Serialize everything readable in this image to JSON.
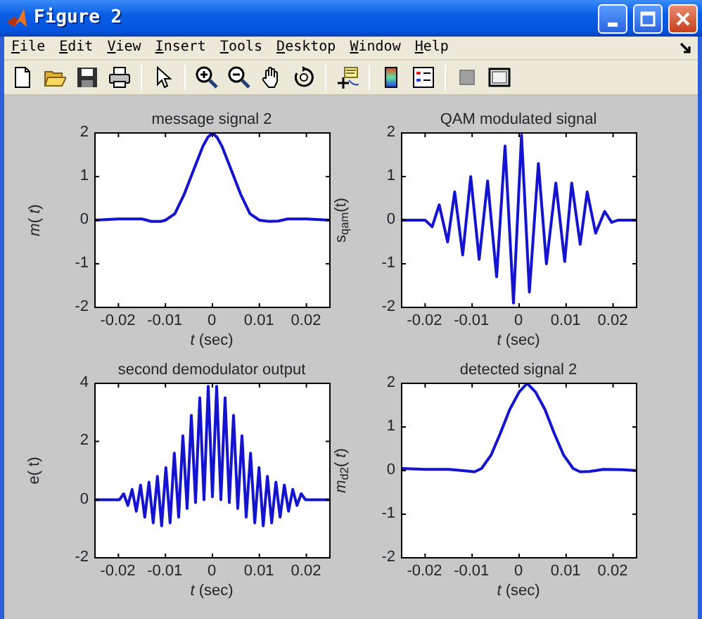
{
  "window": {
    "title": "Figure 2"
  },
  "menu": [
    "File",
    "Edit",
    "View",
    "Insert",
    "Tools",
    "Desktop",
    "Window",
    "Help"
  ],
  "subplots": [
    {
      "chart_data": {
        "type": "line",
        "title": "message signal 2",
        "xlabel": "*t* (sec)",
        "ylabel": "*m*( *t*)",
        "xlim": [
          -0.025,
          0.025
        ],
        "ylim": [
          -2,
          2
        ],
        "xticks": [
          -0.02,
          -0.01,
          0,
          0.01,
          0.02
        ],
        "yticks": [
          -2,
          -1,
          0,
          1,
          2
        ],
        "x": [
          -0.025,
          -0.02,
          -0.015,
          -0.013,
          -0.011,
          -0.01,
          -0.008,
          -0.006,
          -0.004,
          -0.002,
          -0.001,
          0,
          0.001,
          0.002,
          0.004,
          0.006,
          0.008,
          0.01,
          0.012,
          0.014,
          0.016,
          0.02,
          0.025
        ],
        "series": [
          {
            "values": [
              0,
              0.03,
              0.03,
              -0.03,
              -0.03,
              0,
              0.15,
              0.6,
              1.15,
              1.7,
              1.9,
              2,
              1.9,
              1.7,
              1.15,
              0.6,
              0.15,
              0,
              -0.03,
              -0.02,
              0.03,
              0.03,
              0
            ]
          }
        ]
      }
    },
    {
      "chart_data": {
        "type": "line",
        "title": "QAM modulated signal",
        "xlabel": "*t* (sec)",
        "ylabel": "s$_{qam}$(t)",
        "xlim": [
          -0.025,
          0.025
        ],
        "ylim": [
          -2,
          2
        ],
        "xticks": [
          -0.02,
          -0.01,
          0,
          0.01,
          0.02
        ],
        "yticks": [
          -2,
          -1,
          0,
          1,
          2
        ],
        "x": [
          -0.025,
          -0.02,
          -0.0185,
          -0.017,
          -0.0152,
          -0.0137,
          -0.012,
          -0.0103,
          -0.0085,
          -0.0067,
          -0.0048,
          -0.003,
          -0.0012,
          0.0005,
          0.0022,
          0.0041,
          0.0058,
          0.0078,
          0.0097,
          0.0112,
          0.013,
          0.0145,
          0.0163,
          0.0182,
          0.0197,
          0.021,
          0.025
        ],
        "series": [
          {
            "values": [
              0,
              0,
              -0.15,
              0.35,
              -0.5,
              0.65,
              -0.8,
              1,
              -0.9,
              0.9,
              -1.3,
              1.7,
              -1.9,
              1.95,
              -1.65,
              1.3,
              -1,
              0.85,
              -0.95,
              0.85,
              -0.55,
              0.65,
              -0.3,
              0.2,
              -0.05,
              0,
              0
            ]
          }
        ]
      }
    },
    {
      "chart_data": {
        "type": "line",
        "title": "second demodulator output",
        "xlabel": "*t* (sec)",
        "ylabel": "e( t)",
        "xlim": [
          -0.025,
          0.025
        ],
        "ylim": [
          -2,
          4
        ],
        "xticks": [
          -0.02,
          -0.01,
          0,
          0.01,
          0.02
        ],
        "yticks": [
          -2,
          0,
          2,
          4
        ],
        "x": [
          -0.025,
          -0.0198,
          -0.0189,
          -0.018,
          -0.0171,
          -0.0162,
          -0.0153,
          -0.0144,
          -0.0135,
          -0.0126,
          -0.0117,
          -0.0108,
          -0.0099,
          -0.009,
          -0.0081,
          -0.0072,
          -0.0063,
          -0.0054,
          -0.0045,
          -0.0036,
          -0.0027,
          -0.0018,
          -0.0009,
          0,
          0.0009,
          0.0018,
          0.0027,
          0.0036,
          0.0045,
          0.0054,
          0.0063,
          0.0072,
          0.0081,
          0.009,
          0.0099,
          0.0108,
          0.0117,
          0.0126,
          0.0135,
          0.0144,
          0.0153,
          0.0162,
          0.0171,
          0.018,
          0.0189,
          0.0198,
          0.025
        ],
        "series": [
          {
            "values": [
              0,
              0,
              0.2,
              -0.2,
              0.35,
              -0.4,
              0.5,
              -0.6,
              0.6,
              -0.8,
              0.8,
              -0.9,
              1.1,
              -0.8,
              1.6,
              -0.6,
              2.2,
              -0.3,
              2.9,
              -0.1,
              3.5,
              0,
              3.9,
              0.1,
              3.9,
              0,
              3.5,
              -0.1,
              2.9,
              -0.3,
              2.2,
              -0.6,
              1.6,
              -0.8,
              1.1,
              -0.9,
              0.8,
              -0.8,
              0.6,
              -0.6,
              0.5,
              -0.4,
              0.35,
              -0.2,
              0.2,
              0,
              0
            ]
          }
        ]
      }
    },
    {
      "chart_data": {
        "type": "line",
        "title": "detected signal 2",
        "xlabel": "*t* (sec)",
        "ylabel": "*m*$_{d2}$( *t*)",
        "xlim": [
          -0.025,
          0.025
        ],
        "ylim": [
          -2,
          2
        ],
        "xticks": [
          -0.02,
          -0.01,
          0,
          0.01,
          0.02
        ],
        "yticks": [
          -2,
          -1,
          0,
          1,
          2
        ],
        "x": [
          -0.025,
          -0.02,
          -0.015,
          -0.012,
          -0.0095,
          -0.008,
          -0.006,
          -0.004,
          -0.002,
          0,
          0.0017,
          0.0035,
          0.0055,
          0.0075,
          0.0095,
          0.0115,
          0.013,
          0.015,
          0.018,
          0.022,
          0.025
        ],
        "series": [
          {
            "values": [
              0.05,
              0.03,
              0.03,
              0,
              -0.03,
              0.05,
              0.35,
              0.85,
              1.4,
              1.8,
              2,
              1.8,
              1.4,
              0.85,
              0.35,
              0.05,
              -0.03,
              -0.02,
              0.03,
              0.02,
              0
            ]
          }
        ]
      }
    }
  ]
}
